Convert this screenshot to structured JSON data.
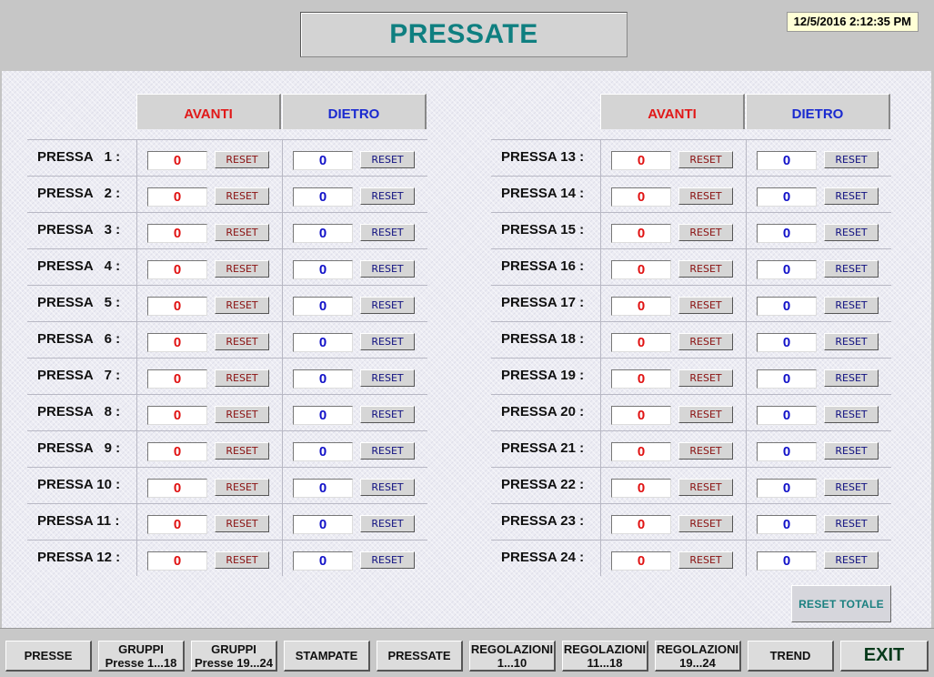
{
  "header": {
    "title": "PRESSATE",
    "datetime": "12/5/2016 2:12:35 PM"
  },
  "columns": {
    "avanti": "AVANTI",
    "dietro": "DIETRO"
  },
  "reset_label": "RESET",
  "presses_left": [
    {
      "label": "PRESSA   1 :",
      "avanti": "0",
      "dietro": "0"
    },
    {
      "label": "PRESSA   2 :",
      "avanti": "0",
      "dietro": "0"
    },
    {
      "label": "PRESSA   3 :",
      "avanti": "0",
      "dietro": "0"
    },
    {
      "label": "PRESSA   4 :",
      "avanti": "0",
      "dietro": "0"
    },
    {
      "label": "PRESSA   5 :",
      "avanti": "0",
      "dietro": "0"
    },
    {
      "label": "PRESSA   6 :",
      "avanti": "0",
      "dietro": "0"
    },
    {
      "label": "PRESSA   7 :",
      "avanti": "0",
      "dietro": "0"
    },
    {
      "label": "PRESSA   8 :",
      "avanti": "0",
      "dietro": "0"
    },
    {
      "label": "PRESSA   9 :",
      "avanti": "0",
      "dietro": "0"
    },
    {
      "label": "PRESSA 10 :",
      "avanti": "0",
      "dietro": "0"
    },
    {
      "label": "PRESSA 11 :",
      "avanti": "0",
      "dietro": "0"
    },
    {
      "label": "PRESSA 12 :",
      "avanti": "0",
      "dietro": "0"
    }
  ],
  "presses_right": [
    {
      "label": "PRESSA 13 :",
      "avanti": "0",
      "dietro": "0"
    },
    {
      "label": "PRESSA 14 :",
      "avanti": "0",
      "dietro": "0"
    },
    {
      "label": "PRESSA 15 :",
      "avanti": "0",
      "dietro": "0"
    },
    {
      "label": "PRESSA 16 :",
      "avanti": "0",
      "dietro": "0"
    },
    {
      "label": "PRESSA 17 :",
      "avanti": "0",
      "dietro": "0"
    },
    {
      "label": "PRESSA 18 :",
      "avanti": "0",
      "dietro": "0"
    },
    {
      "label": "PRESSA 19 :",
      "avanti": "0",
      "dietro": "0"
    },
    {
      "label": "PRESSA 20 :",
      "avanti": "0",
      "dietro": "0"
    },
    {
      "label": "PRESSA 21 :",
      "avanti": "0",
      "dietro": "0"
    },
    {
      "label": "PRESSA 22 :",
      "avanti": "0",
      "dietro": "0"
    },
    {
      "label": "PRESSA 23 :",
      "avanti": "0",
      "dietro": "0"
    },
    {
      "label": "PRESSA 24 :",
      "avanti": "0",
      "dietro": "0"
    }
  ],
  "reset_totale": "RESET  TOTALE",
  "nav": [
    {
      "line1": "PRESSE",
      "line2": ""
    },
    {
      "line1": "GRUPPI",
      "line2": "Presse 1...18"
    },
    {
      "line1": "GRUPPI",
      "line2": "Presse 19...24"
    },
    {
      "line1": "STAMPATE",
      "line2": ""
    },
    {
      "line1": "PRESSATE",
      "line2": ""
    },
    {
      "line1": "REGOLAZIONI",
      "line2": "1...10"
    },
    {
      "line1": "REGOLAZIONI",
      "line2": "11...18"
    },
    {
      "line1": "REGOLAZIONI",
      "line2": "19...24"
    },
    {
      "line1": "TREND",
      "line2": ""
    },
    {
      "line1": "EXIT",
      "line2": ""
    }
  ],
  "colors": {
    "avanti": "#e11818",
    "dietro": "#1a2ad0",
    "title": "#0f7f80"
  }
}
